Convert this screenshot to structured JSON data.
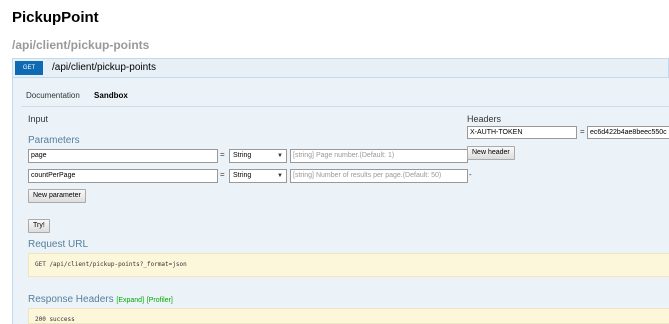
{
  "app": {
    "title": "PickupPoint"
  },
  "route": {
    "path": "/api/client/pickup-points"
  },
  "operation": {
    "method": "GET",
    "path": "/api/client/pickup-points"
  },
  "tabs": [
    {
      "label": "Documentation",
      "active": false
    },
    {
      "label": "Sandbox",
      "active": true
    }
  ],
  "input": {
    "title": "Input",
    "parameters_title": "Parameters",
    "params": [
      {
        "name": "page",
        "type": "String",
        "placeholder": "[string] Page number.(Default: 1)"
      },
      {
        "name": "countPerPage",
        "type": "String",
        "placeholder": "[string] Number of results per page.(Default: 50)"
      }
    ],
    "eq": "=",
    "dash": "-",
    "new_parameter_label": "New parameter",
    "try_label": "Try!"
  },
  "headers": {
    "title": "Headers",
    "items": [
      {
        "name": "X-AUTH-TOKEN",
        "value": "ec6d422b4ae8beec550c"
      }
    ],
    "eq": "=",
    "new_header_label": "New header"
  },
  "request": {
    "title": "Request URL",
    "url": "GET /api/client/pickup-points?_format=json"
  },
  "response": {
    "title": "Response Headers",
    "expand_label": "[Expand]",
    "profiler_label": "[Profiler]",
    "status": "200 success"
  },
  "colors": {
    "method_badge": "#0f6ab4",
    "panel_bg": "#ebf3f9",
    "code_bg": "#fcf6db",
    "section_title": "#547f9d"
  }
}
